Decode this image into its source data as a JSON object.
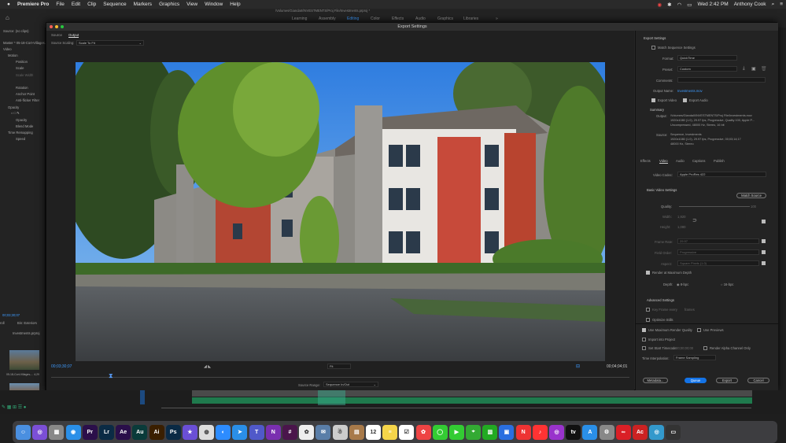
{
  "menubar": {
    "app": "Premiere Pro",
    "items": [
      "File",
      "Edit",
      "Clip",
      "Sequence",
      "Markers",
      "Graphics",
      "View",
      "Window",
      "Help"
    ],
    "clock": "Wed 2:42 PM",
    "user": "Anthony Cook"
  },
  "workspaces": [
    "Learning",
    "Assembly",
    "Editing",
    "Color",
    "Effects",
    "Audio",
    "Graphics",
    "Libraries"
  ],
  "active_workspace": "Editing",
  "project_path": "/Volumes/GiandaII/INVESTMENTS/Proj File/Investments.prproj *",
  "left_panel": {
    "source_label": "Source: (no clips)",
    "master_label": "Master * 05-18-Cort-Villages...",
    "video_label": "Video",
    "controls": [
      "Motion",
      "Position",
      "Scale",
      "Scale Width",
      "Rotation",
      "Anchor Point",
      "Anti-flicker Filter",
      "Opacity",
      "Opacity",
      "Blend Mode",
      "Time Remapping",
      "Speed"
    ],
    "timecode": "00;03;30;07",
    "project_tabs": [
      "roll",
      "Bin: Exteriors"
    ],
    "project_file": "Investments.prproj",
    "clip_label": "05-18-Cort-Villages-... 4;29"
  },
  "dialog": {
    "title": "Export Settings",
    "tabs": [
      "Source",
      "Output"
    ],
    "active_tab": "Output",
    "source_scaling_label": "Source Scaling:",
    "source_scaling_value": "Scale To Fit",
    "timecode_in": "00;03;30;07",
    "timecode_out": "00;04;04;01",
    "fit": "Fit",
    "source_range_label": "Source Range:",
    "source_range_value": "Sequence In/Out"
  },
  "export_settings": {
    "section": "Export Settings",
    "match_sequence": "Match Sequence Settings",
    "format_label": "Format:",
    "format_value": "QuickTime",
    "preset_label": "Preset:",
    "preset_value": "Custom",
    "comments_label": "Comments:",
    "output_name_label": "Output Name:",
    "output_name_value": "Investments.mov",
    "export_video": "Export Video",
    "export_audio": "Export Audio",
    "summary_label": "Summary",
    "summary_output_label": "Output:",
    "summary_output": "/Volumes/GiandaII/INVESTMENTS/Proj File/Investments.mov",
    "summary_output_2": "1920x1080 (1.0), 29.97 fps, Progressive, Quality 100, Apple P...",
    "summary_output_3": "Uncompressed, 48000 Hz, Stereo, 16 bit",
    "summary_source_label": "Source:",
    "summary_source": "Sequence, Investments",
    "summary_source_2": "1920x1080 (1.0), 29.97 fps, Progressive, 00;03;14;17",
    "summary_source_3": "48000 Hz, Stereo",
    "tabs": [
      "Effects",
      "Video",
      "Audio",
      "Captions",
      "Publish"
    ],
    "active_tab": "Video",
    "video_codec_label": "Video Codec:",
    "video_codec_value": "Apple ProRes 422",
    "basic_video": "Basic Video Settings",
    "match_source": "Match Source",
    "quality_label": "Quality:",
    "quality_value": "100",
    "width_label": "Width:",
    "width_value": "1,920",
    "height_label": "Height:",
    "height_value": "1,080",
    "frame_rate_label": "Frame Rate:",
    "frame_rate_value": "29.97",
    "field_order_label": "Field Order:",
    "field_order_value": "Progressive",
    "aspect_label": "Aspect:",
    "aspect_value": "Square Pixels (1.0)",
    "render_max_depth": "Render at Maximum Depth",
    "depth_label": "Depth:",
    "depth_8": "8-bpc",
    "depth_16": "16-bpc",
    "advanced": "Advanced Settings",
    "key_frame": "Key Frame every",
    "frames": "frames",
    "optimize_stills": "Optimize Stills",
    "use_max_render": "Use Maximum Render Quality",
    "use_previews": "Use Previews",
    "import_into_project": "Import into Project",
    "set_start_timecode": "Set Start Timecode",
    "start_timecode_value": "00;00;00;00",
    "render_alpha": "Render Alpha Channel Only",
    "time_interp_label": "Time Interpolation:",
    "time_interp_value": "Frame Sampling",
    "buttons": [
      "Metadata...",
      "Queue",
      "Export",
      "Cancel"
    ]
  },
  "dock_apps": [
    "Finder",
    "Siri",
    "Launchpad",
    "Safari",
    "Premiere Pro",
    "Lightroom",
    "After Effects",
    "Audition",
    "Illustrator",
    "Photoshop",
    "iMovie",
    "Chrome",
    "Zoom",
    "Mail Direct",
    "Teams",
    "OneNote",
    "Slack",
    "Photos",
    "Preview",
    "Keychain",
    "Calendar",
    "Notes",
    "Reminders",
    "Photos",
    "Messages",
    "FaceTime",
    "Maps",
    "Numbers",
    "Keynote",
    "News",
    "Music",
    "Podcasts",
    "TV",
    "App Store",
    "System Preferences",
    "Creative Cloud",
    "Acrobat",
    "Network",
    "Downloads",
    "Trash"
  ]
}
